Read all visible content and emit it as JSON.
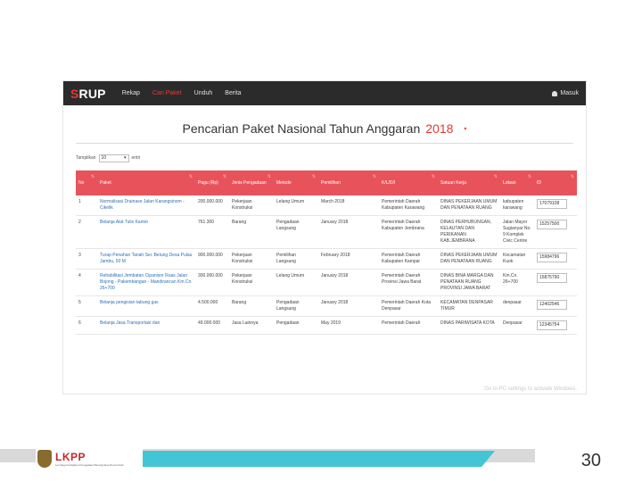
{
  "navbar": {
    "logo_s": "S",
    "logo_rest": "RUP",
    "items": [
      "Rekap",
      "Cari Paket",
      "Unduh",
      "Berita"
    ],
    "login": "Masuk"
  },
  "title": {
    "text": "Pencarian Paket Nasional Tahun Anggaran",
    "year": "2018"
  },
  "show": {
    "label": "Tampilkan",
    "value": "10",
    "suffix": "entri"
  },
  "table": {
    "headers": [
      "No",
      "Paket",
      "Pagu (Rp)",
      "Jenis Pengadaan",
      "Metode",
      "Pemilihan",
      "K/L/D/I",
      "Satuan Kerja",
      "Lokasi",
      "ID"
    ],
    "rows": [
      [
        "1",
        "Normalisasi Drainase Jalan Karangsinom - Cikelik",
        "200.000.000",
        "Pekerjaan Konstruksi",
        "Lelang Umum",
        "March 2018",
        "Pemerintah Daerah Kabupaten Karawang",
        "DINAS PEKERJAAN UMUM DAN PENATAAN RUANG",
        "kabupaten karawang",
        "17079108"
      ],
      [
        "2",
        "Belanja Alat Tulis Kantor",
        "761.300",
        "Barang",
        "Pengadaan Langsung",
        "January 2018",
        "Pemerintah Daerah Kabupaten Jembrana",
        "DINAS PERHUBUNGAN, KELAUTAN DAN PERIKANAN KAB.JEMBRANA",
        "Jalan Mayor Sugianyar No. 9 Komplek Civic Centre",
        "15257500"
      ],
      [
        "3",
        "Turap Penahan Tanah Sei. Belung Desa Pulau Jambu, 50 M",
        "900.000.000",
        "Pekerjaan Konstruksi",
        "Pemilihan Langsung",
        "February 2018",
        "Pemerintah Daerah Kabupaten Kampar",
        "DINAS PEKERJAAN UMUM DAN PENATAAN RUANG",
        "Kecamatan Kuok",
        "15984796"
      ],
      [
        "4",
        "Rehabilitasi Jembatan Cipanisor Ruas Jalan Bojong - Pakembangan - Mandirancan Km.Cn. 26+700",
        "300.000.000",
        "Pekerjaan Konstruksi",
        "Lelang Umum",
        "January 2018",
        "Pemerintah Daerah Provinsi Jawa Barat",
        "DINAS BINA MARGA DAN PENATAAN RUANG PROVINSI JAWA BARAT",
        "Km.Cn. 26+700",
        "15875790"
      ],
      [
        "5",
        "Belanja pengisian tabung gas",
        "4.500.000",
        "Barang",
        "Pengadaan Langsung",
        "January 2018",
        "Pemerintah Daerah Kota Denpasar",
        "KECAMATAN DENPASAR TIMUR",
        "denpasar",
        "12402546"
      ],
      [
        "6",
        "Belanja Jasa Transportasi dan",
        "49.000.000",
        "Jasa Lainnya",
        "Pengadaan",
        "May 2019",
        "Pemerintah Daerah",
        "DINAS PARIWISATA KOTA",
        "Denpasar",
        "12345754"
      ]
    ]
  },
  "watermark": "Go to PC settings to activate Windows.",
  "footer": {
    "org": "LKPP",
    "org_sub": "Lembaga Kebijakan Pengadaan Barang/Jasa Pemerintah",
    "page_number": "30"
  }
}
